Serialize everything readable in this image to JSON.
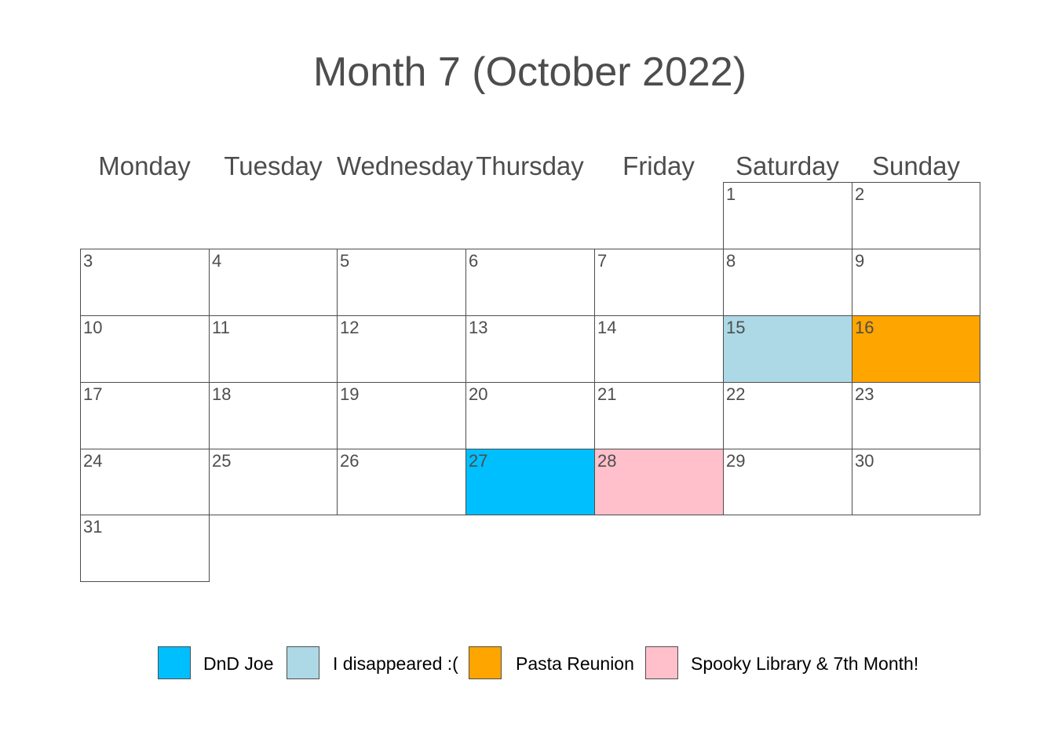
{
  "title": "Month 7 (October 2022)",
  "weekdays": [
    "Monday",
    "Tuesday",
    "Wednesday",
    "Thursday",
    "Friday",
    "Saturday",
    "Sunday"
  ],
  "colors": {
    "dnd_joe": "#00bfff",
    "i_disappeared": "#add8e6",
    "pasta_reunion": "#ffa500",
    "spooky_library": "#ffc0cb",
    "empty": "#ffffff",
    "border": "#4d4d4d",
    "text": "#4d4d4d"
  },
  "chart_data": {
    "type": "calendar-heatmap",
    "month": "October 2022",
    "first_weekday": "Saturday",
    "days_in_month": 31,
    "events": [
      {
        "day": 15,
        "event": "I disappeared :("
      },
      {
        "day": 16,
        "event": "Pasta Reunion"
      },
      {
        "day": 27,
        "event": "DnD Joe"
      },
      {
        "day": 28,
        "event": "Spooky Library & 7th Month!"
      }
    ],
    "legend": [
      {
        "label": "DnD Joe",
        "color": "#00bfff"
      },
      {
        "label": "I disappeared :(",
        "color": "#add8e6"
      },
      {
        "label": "Pasta Reunion",
        "color": "#ffa500"
      },
      {
        "label": "Spooky Library & 7th Month!",
        "color": "#ffc0cb"
      }
    ],
    "legend_position": "bottom"
  }
}
